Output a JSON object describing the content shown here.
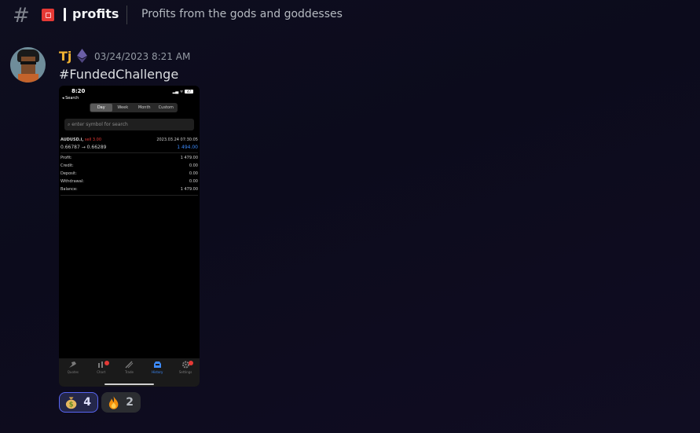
{
  "channel": {
    "icon": "hash-icon",
    "emoji": "red-square-emoji",
    "name": "profits",
    "topic": "Profits from the gods and goddesses"
  },
  "message": {
    "author": "Tj",
    "role_icon": "ethereum-diamond-icon",
    "timestamp": "03/24/2023 8:21 AM",
    "text": "#FundedChallenge",
    "colors": {
      "author": "#f0b232"
    }
  },
  "attachment": {
    "status_time": "8:20",
    "battery": "47",
    "back_label": "◂ Search",
    "periods": [
      "Day",
      "Week",
      "Month",
      "Custom"
    ],
    "active_period": "Day",
    "search_placeholder": "enter symbol for search",
    "deal": {
      "symbol": "AUDUSD.i,",
      "side": "sell 3.00",
      "datetime": "2023.03.24 07:30:05",
      "prices": "0.66787 → 0.66289",
      "result": "1 494.00"
    },
    "summary": [
      {
        "label": "Profit:",
        "value": "1 479.00"
      },
      {
        "label": "Credit:",
        "value": "0.00"
      },
      {
        "label": "Deposit:",
        "value": "0.00"
      },
      {
        "label": "Withdrawal:",
        "value": "0.00"
      },
      {
        "label": "Balance:",
        "value": "1 479.00"
      }
    ],
    "tabs": [
      "Quotes",
      "Chart",
      "Trade",
      "History",
      "Settings"
    ],
    "active_tab": "History"
  },
  "reactions": [
    {
      "emoji": "money-bag-emoji",
      "count": "4",
      "reacted": true
    },
    {
      "emoji": "fire-emoji",
      "count": "2",
      "reacted": false
    }
  ]
}
